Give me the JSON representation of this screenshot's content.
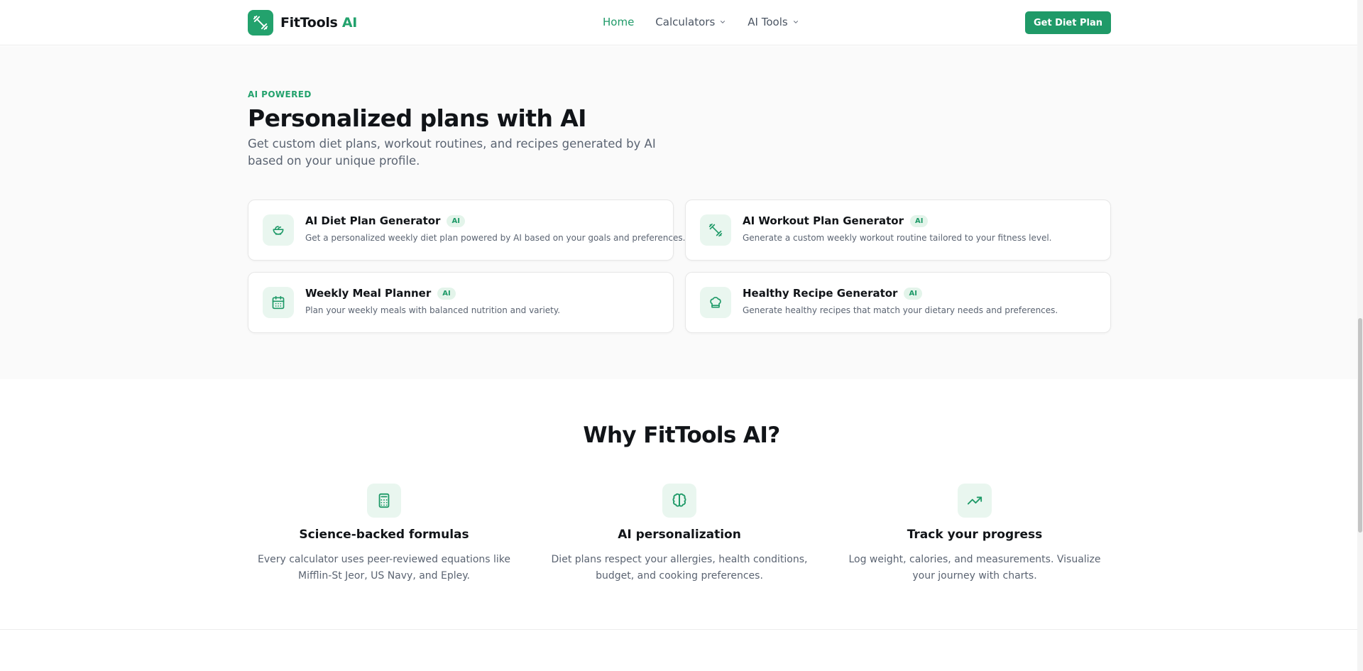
{
  "header": {
    "brand": "FitTools",
    "brand_accent": "AI",
    "nav": [
      {
        "label": "Home",
        "active": true
      },
      {
        "label": "Calculators",
        "dropdown": true
      },
      {
        "label": "AI Tools",
        "dropdown": true
      }
    ],
    "cta_label": "Get Diet Plan"
  },
  "ai_section": {
    "eyebrow": "AI POWERED",
    "title": "Personalized plans with AI",
    "subtitle": "Get custom diet plans, workout routines, and recipes generated by AI based on your unique profile.",
    "cards": [
      {
        "icon": "salad-bowl-icon",
        "title": "AI Diet Plan Generator",
        "badge": "AI",
        "description": "Get a personalized weekly diet plan powered by AI based on your goals and preferences."
      },
      {
        "icon": "dumbbell-icon",
        "title": "AI Workout Plan Generator",
        "badge": "AI",
        "description": "Generate a custom weekly workout routine tailored to your fitness level."
      },
      {
        "icon": "calendar-icon",
        "title": "Weekly Meal Planner",
        "badge": "AI",
        "description": "Plan your weekly meals with balanced nutrition and variety."
      },
      {
        "icon": "chef-hat-icon",
        "title": "Healthy Recipe Generator",
        "badge": "AI",
        "description": "Generate healthy recipes that match your dietary needs and preferences."
      }
    ]
  },
  "why_section": {
    "title": "Why FitTools AI?",
    "features": [
      {
        "icon": "calculator-icon",
        "title": "Science-backed formulas",
        "description": "Every calculator uses peer-reviewed equations like Mifflin-St Jeor, US Navy, and Epley."
      },
      {
        "icon": "brain-icon",
        "title": "AI personalization",
        "description": "Diet plans respect your allergies, health conditions, budget, and cooking preferences."
      },
      {
        "icon": "trending-up-icon",
        "title": "Track your progress",
        "description": "Log weight, calories, and measurements. Visualize your journey with charts."
      }
    ]
  },
  "colors": {
    "accent": "#1f9a68",
    "accent_light": "#e9f6ef",
    "text_dark": "#111418",
    "text_muted": "#5b6472",
    "section_bg": "#fafafa"
  }
}
